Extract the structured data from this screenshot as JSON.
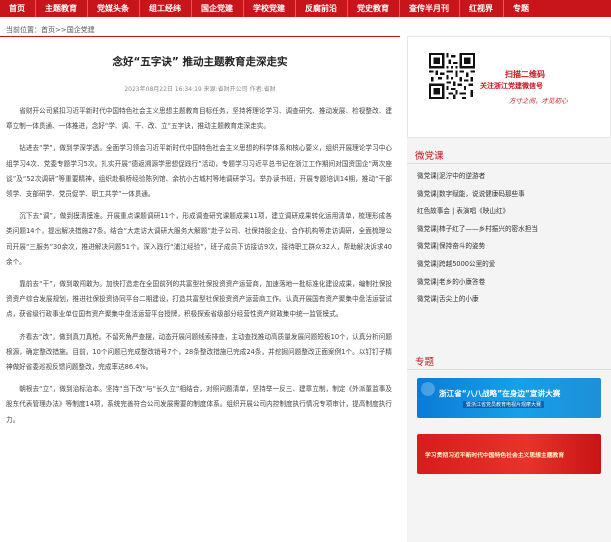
{
  "nav": {
    "items": [
      "首页",
      "主题教育",
      "党媒头条",
      "组工经纬",
      "国企党建",
      "学校党建",
      "反腐前沿",
      "党史教育",
      "查传半月刊",
      "红视界",
      "专题"
    ]
  },
  "breadcrumb": {
    "prefix": "当前位置：",
    "home": "首页",
    "sep": ">>",
    "current": "国企党建"
  },
  "article": {
    "title": "念好“五字诀” 推动主题教育走深走实",
    "meta": "2023年08月22日 16:34:19 来源:省财开公司 作者:省财",
    "paragraphs": [
      "省财开公司紧扣习近平新时代中国特色社会主义思想主题教育目标任务，坚持将理论学习、调查研究、推动发展、检视整改、建章立制一体贯通、一体推进，念好“学、调、干、改、立”五字诀，推动主题教育走深走实。",
      "钻进去“学”，做到学深学透。全面学习领会习近平新时代中国特色社会主义思想的科学体系和核心要义，组织开展理论学习中心组学习4次、党委专题学习5次。扎实开展“德返溯源学思想促践行”活动，专题学习习近平总书记在浙江工作期间对国资国企“两次座谈”及“52次调研”等重要精神，组织赴枫桥经验陈列馆、余杭小古城村等地调研学习。举办读书班，开展专题培训14期，推动“干部领学、支部研学、党员促学、职工共学”一体贯通。",
      "沉下去“调”，做到摸清摸准。开展重点课题调研11个，形成调查研究课题成果11项，建立调研成果转化运用清单，梳理形成各类问题14个，提出解决措施27条。结合“大走访大调研大服务大解题”赴子公司、社保持股企业、合作机构等走访调研，全面梳理公司开展“三服务”30余次，推进解决问题51个。深入践行“浦江经验”，班子成员下访接访9次，接待职工群众32人，帮助解决诉求40余个。",
      "靠前去“干”，做到敢闯敢为。加快打造走在全国前列的共富型社保投资资产运营商，加速落地一批标准化建设成果，编制社保投资资产综合发展规划，推进社保投资协同平台二期建设，打造共富型社保投资资产运营商工作。认真开展国有资产聚集中盘活运营试点，获省级行政事业单位国有资产聚集中盘活运营平台授牌，积极探索省级部分经营性资产财政集中统一监管模式。",
      "齐看去“改”，做到真刀真枪。不留死角严查摆，动态开展问题线索排查，主动查找推动高质量发展问题短板10个，认真分析问题根源，确定整改措施。目前，10个问题已完成整改销号7个，28条整改措施已完成24条，并挖掘问题整改正面案例1个。以钉钉子精神做好省委巡视反馈问题整改，完成率达86.4%。",
      "朝根去“立”，做到治标治本。坚持“当下改”与“长久立”相结合，对照问题清单，坚持举一反三、建章立制，制定《外派董监事及股东代表管理办法》等制度14项，系统完善符合公司发展需要的制度体系。组织开展公司内控制度执行情况专项审计，提高制度执行力。"
    ]
  },
  "sidebar": {
    "qr": {
      "line1": "扫描二维码",
      "line2": "关注浙江党建微信号",
      "line3": "方寸之间，才见初心"
    },
    "video_heading": "微党课",
    "video_items": [
      "微党课|泥泞中的逆游者",
      "微党课|数字赋能，说说健康码那些事",
      "红色故事会 | 表演唱《映山红》",
      "微党课|柿子红了——乡村振兴的密水担当",
      "微党课|保持奋斗的姿势",
      "微党课|跨越5000公里的爱",
      "微党课|老乡的小康答卷",
      "微党课|舌尖上的小康"
    ],
    "topic_heading": "专题",
    "banner1": {
      "main": "浙江省“八八战略”在身边”宣讲大赛",
      "sub": "暨浙江省党员教育电视片观摩大赛"
    },
    "banner2": {
      "main": "学习贯彻习近平新时代中国特色社会主义思想主题教育"
    }
  },
  "colors": {
    "brand_red": "#c8141b",
    "banner_blue": "#0a7bd6"
  }
}
